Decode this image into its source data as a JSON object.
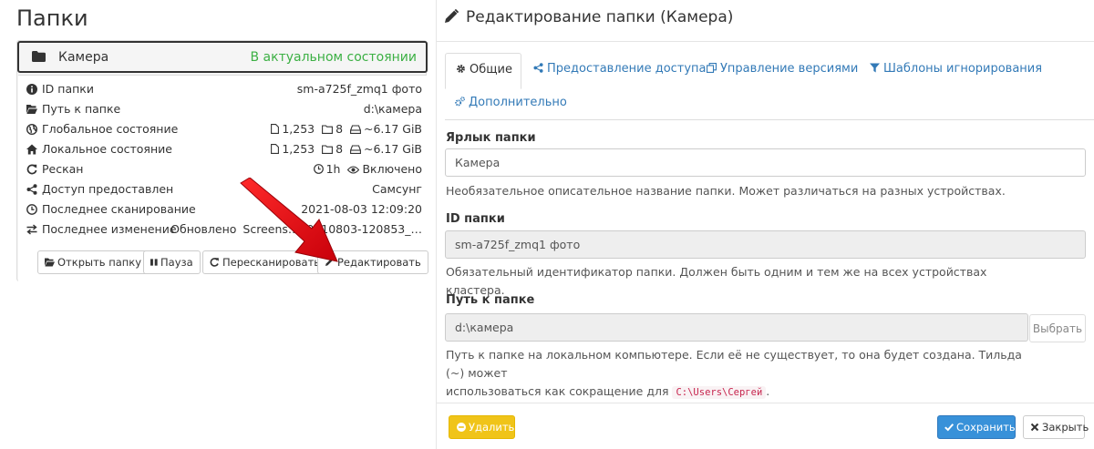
{
  "left": {
    "title": "Папки",
    "folder": {
      "name": "Камера",
      "state": "В актуальном состоянии",
      "rows": [
        {
          "label": "ID папки",
          "value": "sm-a725f_zmq1 фото"
        },
        {
          "label": "Путь к папке",
          "value": "d:\\камера"
        },
        {
          "label": "Глобальное состояние",
          "files": "1,253",
          "dirs": "8",
          "size": "~6.17 GiB"
        },
        {
          "label": "Локальное состояние",
          "files": "1,253",
          "dirs": "8",
          "size": "~6.17 GiB"
        },
        {
          "label": "Рескан",
          "interval": "1h",
          "watch": "Включено"
        },
        {
          "label": "Доступ предоставлен",
          "value": "Самсунг"
        },
        {
          "label": "Последнее сканирование",
          "value": "2021-08-03 12:09:20"
        },
        {
          "label": "Последнее изменение",
          "action": "Обновлено",
          "file": "Screens…20210803-120853_…"
        }
      ],
      "buttons": {
        "open": "Открыть папку",
        "pause": "Пауза",
        "rescan": "Пересканировать",
        "edit": "Редактировать"
      }
    }
  },
  "right": {
    "title": "Редактирование папки (Камера)",
    "tabs": [
      "Общие",
      "Предоставление доступа",
      "Управление версиями",
      "Шаблоны игнорирования",
      "Дополнительно"
    ],
    "fields": {
      "label": {
        "title": "Ярлык папки",
        "value": "Камера",
        "help": "Необязательное описательное название папки. Может различаться на разных устройствах."
      },
      "id": {
        "title": "ID папки",
        "value": "sm-a725f_zmq1 фото",
        "help": "Обязательный идентификатор папки. Должен быть одним и тем же на всех устройствах кластера."
      },
      "path": {
        "title": "Путь к папке",
        "value": "d:\\камера",
        "browse": "Выбрать",
        "help_line1": "Путь к папке на локальном компьютере. Если её не существует, то она будет создана. Тильда (~) может",
        "help_line2_prefix": "использоваться как сокращение для",
        "help_code": "C:\\Users\\Сергей",
        "help_line2_suffix": "."
      }
    },
    "footer": {
      "delete": "Удалить",
      "save": "Сохранить",
      "close": "Закрыть"
    }
  },
  "colors": {
    "ok_green": "#3cb044",
    "link_blue": "#337ab7",
    "save_blue": "#3891d9",
    "delete_yellow": "#f0c419",
    "arrow_red": "#e8141c"
  }
}
